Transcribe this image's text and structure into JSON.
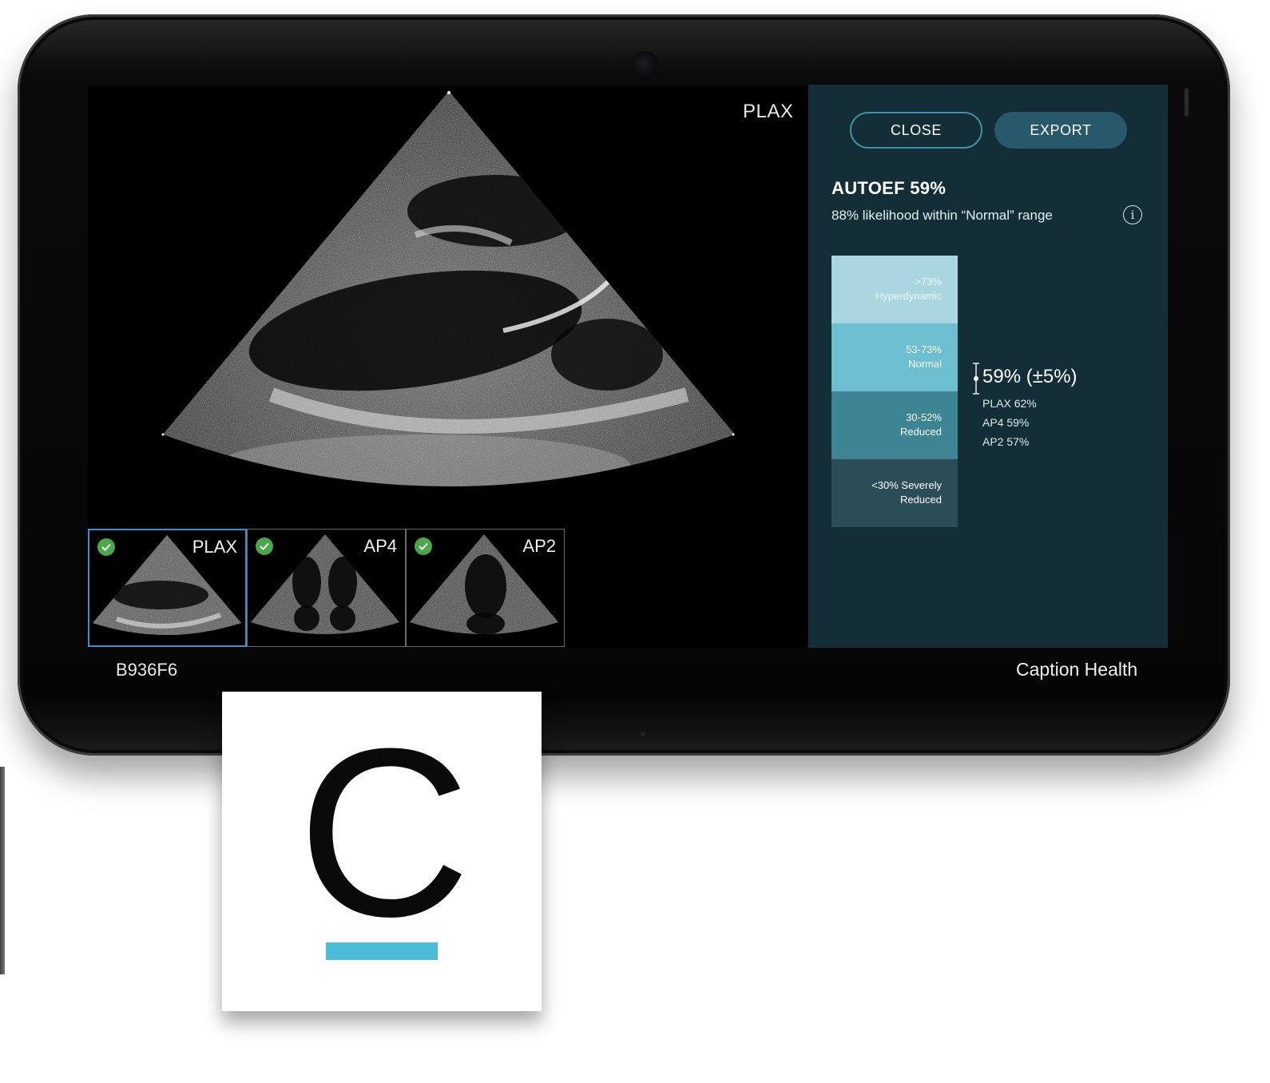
{
  "viewer": {
    "current_view": "PLAX",
    "thumbnails": [
      {
        "label": "PLAX",
        "selected": true,
        "status": "check-icon"
      },
      {
        "label": "AP4",
        "selected": false,
        "status": "check-icon"
      },
      {
        "label": "AP2",
        "selected": false,
        "status": "check-icon"
      }
    ],
    "patient_id": "B936F6"
  },
  "panel": {
    "close_label": "CLOSE",
    "export_label": "EXPORT",
    "title": "AUTOEF 59%",
    "subtitle": "88% likelihood within “Normal” range",
    "info_icon": "info-icon",
    "scale": [
      {
        "range": ">73%",
        "label": "Hyperdynamic",
        "color": "#a9d6df"
      },
      {
        "range": "53-73%",
        "label": "Normal",
        "color": "#6cbfd1"
      },
      {
        "range": "30-52%",
        "label": "Reduced",
        "color": "#3d8494"
      },
      {
        "range": "<30% Severely",
        "label": "Reduced",
        "color": "#2b4d57"
      }
    ],
    "estimate": "59% (±5%)",
    "view_estimates": [
      "PLAX 62%",
      "AP4 59%",
      "AP2 57%"
    ]
  },
  "branding": {
    "name": "Caption Health",
    "logo_letter": "C",
    "accent_color": "#4dbcd6"
  }
}
